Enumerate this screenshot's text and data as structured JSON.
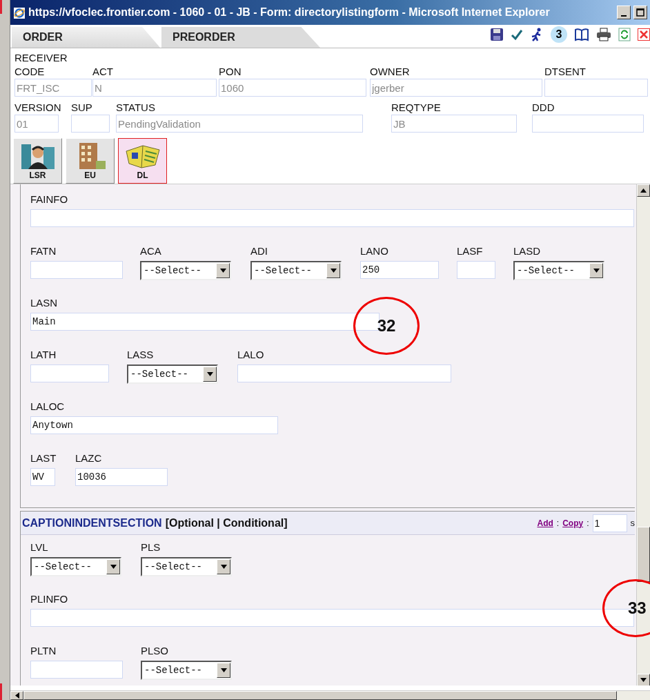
{
  "window": {
    "title": "https://vfoclec.frontier.com - 1060 - 01 - JB - Form: directorylistingform - Microsoft Internet Explorer"
  },
  "tabs": [
    {
      "label": "ORDER",
      "selected": true
    },
    {
      "label": "PREORDER",
      "selected": false
    }
  ],
  "toolbar": {
    "badge": "3"
  },
  "header_rows": [
    [
      {
        "label": "RECEIVER CODE",
        "value": "FRT_ISC"
      },
      {
        "label": "ACT",
        "value": "N"
      },
      {
        "label": "PON",
        "value": "1060"
      },
      {
        "label": "OWNER",
        "value": "jgerber"
      },
      {
        "label": "DTSENT"
      }
    ],
    [
      {
        "label": "VERSION",
        "value": "01"
      },
      {
        "label": "SUP"
      },
      {
        "label": "STATUS",
        "value": "PendingValidation"
      },
      {
        "label": "REQTYPE",
        "value": "JB"
      },
      {
        "label": "DDD"
      }
    ]
  ],
  "form_tabs": [
    {
      "label": "LSR",
      "selected": false
    },
    {
      "label": "EU",
      "selected": false
    },
    {
      "label": "DL",
      "selected": true
    }
  ],
  "sections": [
    {
      "rows": [
        [
          {
            "label": "FAINFO",
            "kind": "text"
          }
        ],
        [
          {
            "label": "FATN",
            "kind": "text"
          },
          {
            "label": "ACA",
            "kind": "select",
            "value": "--Select--"
          },
          {
            "label": "ADI",
            "kind": "select",
            "value": "--Select--"
          },
          {
            "label": "LANO",
            "kind": "text",
            "value": "250"
          },
          {
            "label": "LASF",
            "kind": "text"
          },
          {
            "label": "LASD",
            "kind": "select",
            "value": "--Select--"
          }
        ],
        [
          {
            "label": "LASN",
            "kind": "text",
            "value": "Main"
          }
        ],
        [
          {
            "label": "LATH",
            "kind": "text"
          },
          {
            "label": "LASS",
            "kind": "select",
            "value": "--Select--"
          },
          {
            "label": "LALO",
            "kind": "text"
          }
        ],
        [
          {
            "label": "LALOC",
            "kind": "text",
            "value": "Anytown"
          }
        ],
        [
          {
            "label": "LAST",
            "kind": "text",
            "value": "WV"
          },
          {
            "label": "LAZC",
            "kind": "text",
            "value": "10036"
          }
        ]
      ]
    },
    {
      "title": "CAPTIONINDENTSECTION",
      "qualifier": "[Optional | Conditional]",
      "actions": [
        {
          "label": "Add",
          "separator": ":"
        },
        {
          "label": "Copy",
          "separator": ":"
        }
      ],
      "count": "1",
      "trailing_text": "s",
      "rows": [
        [
          {
            "label": "LVL",
            "kind": "select",
            "value": "--Select--"
          },
          {
            "label": "PLS",
            "kind": "select",
            "value": "--Select--"
          }
        ],
        [
          {
            "label": "PLINFO",
            "kind": "text"
          }
        ],
        [
          {
            "label": "PLTN",
            "kind": "text"
          },
          {
            "label": "PLSO",
            "kind": "select",
            "value": "--Select--"
          }
        ]
      ]
    }
  ],
  "callouts": [
    {
      "label": "32"
    },
    {
      "label": "33"
    }
  ]
}
